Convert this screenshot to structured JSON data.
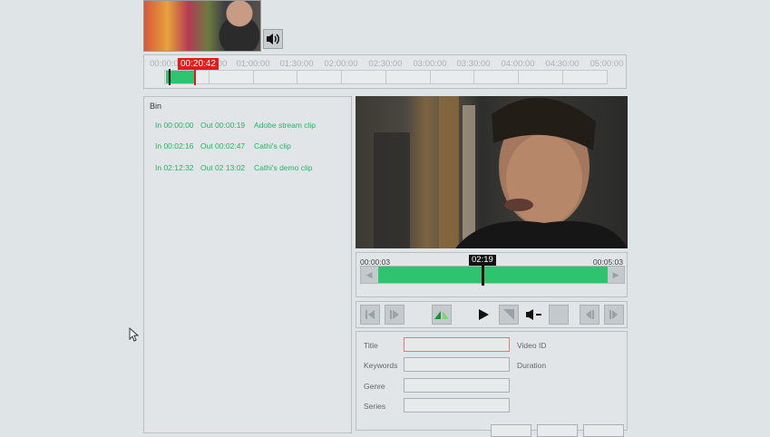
{
  "timeline": {
    "tick_labels": [
      "00:00:0",
      "01:00:00",
      "01:30:00",
      "02:00:00",
      "02:30:00",
      "03:00:00",
      "03:30:00",
      "04:00:00",
      "04:30:00",
      "05:00:00"
    ],
    "hidden_tick_tail": "00",
    "current_time": "00:20:42"
  },
  "bin": {
    "title": "Bin",
    "clips": [
      {
        "in": "In 00:00:00",
        "out": "Out 00:00:19",
        "name": "Adobe stream clip"
      },
      {
        "in": "In 00:02:16",
        "out": "Out 00:02:47",
        "name": "Cathi's clip"
      },
      {
        "in": "In 02:12:32",
        "out": "Out 02 13:02",
        "name": "Cathi's demo clip"
      }
    ]
  },
  "scrubber": {
    "start": "00:00:03",
    "end": "00:05:03",
    "playhead": "02:19"
  },
  "metadata": {
    "title_label": "Title",
    "keywords_label": "Keywords",
    "genre_label": "Genre",
    "series_label": "Series",
    "video_id_label": "Video ID",
    "duration_label": "Duration"
  },
  "colors": {
    "accent_green": "#2ec46f",
    "clip_text_green": "#1fb865",
    "marker_red": "#e41b1b"
  },
  "icons": [
    "speaker-icon",
    "step-back-icon",
    "step-forward-icon",
    "mark-range-icon",
    "play-icon",
    "next-frame-icon",
    "volume-down-icon",
    "skip-back-icon",
    "skip-forward-icon",
    "cursor-icon"
  ]
}
